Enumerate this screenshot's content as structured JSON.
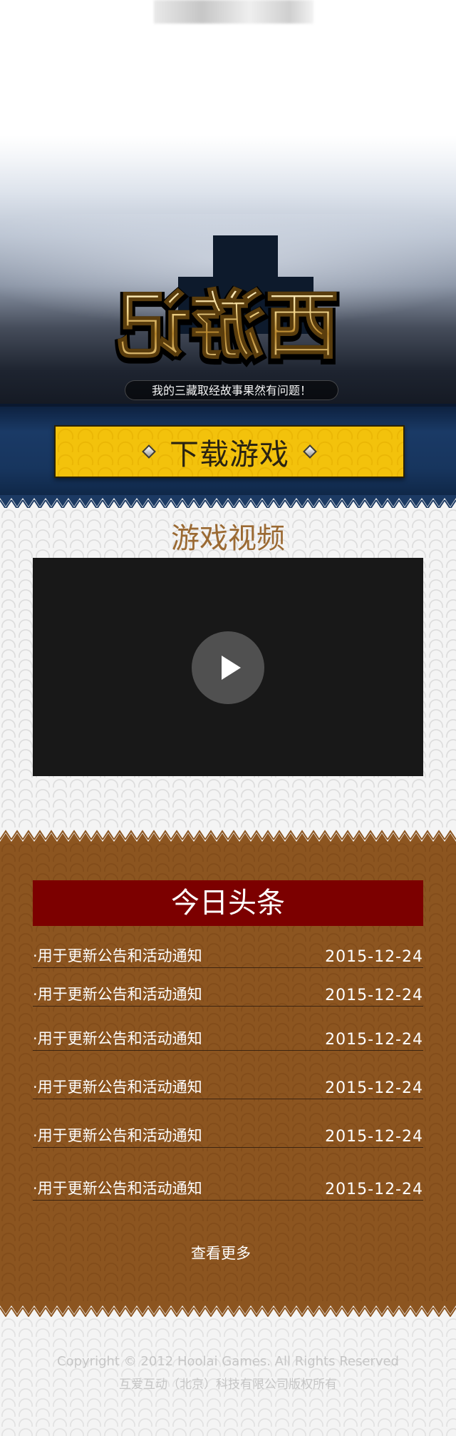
{
  "hero": {
    "logo_text": "西游记",
    "slogan": "我的三藏取经故事果然有问题！"
  },
  "download": {
    "label": "下载游戏"
  },
  "video": {
    "title": "游戏视频"
  },
  "news": {
    "header": "今日头条",
    "items": [
      {
        "title": "·用于更新公告和活动通知",
        "date": "2015-12-24"
      },
      {
        "title": "·用于更新公告和活动通知",
        "date": "2015-12-24"
      },
      {
        "title": "·用于更新公告和活动通知",
        "date": "2015-12-24"
      },
      {
        "title": "·用于更新公告和活动通知",
        "date": "2015-12-24"
      },
      {
        "title": "·用于更新公告和活动通知",
        "date": "2015-12-24"
      },
      {
        "title": "·用于更新公告和活动通知",
        "date": "2015-12-24"
      }
    ],
    "more_label": "查看更多"
  },
  "footer": {
    "copyright": "Copyright © 2012 Hoolai Games. All Rights Reserved",
    "company": "互爱互动（北京）科技有限公司版权所有"
  },
  "colors": {
    "download_yellow": "#f3c20c",
    "news_brown": "#8c5520",
    "news_header_red": "#7c0000",
    "video_title_brown": "#9b6a33",
    "band_blue": "#1a3a66"
  }
}
